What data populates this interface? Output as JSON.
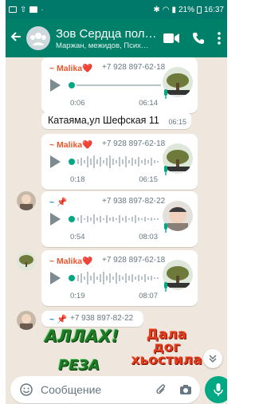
{
  "status_bar": {
    "battery": "21%",
    "time": "16:37"
  },
  "header": {
    "back_icon": "arrow-left-icon",
    "title": "Зов Сердца пол…",
    "subtitle": "Маржан, межидов, Псих…",
    "icons": [
      "video-call-icon",
      "phone-call-icon",
      "more-vert-icon"
    ],
    "accent": "#008069"
  },
  "messages": [
    {
      "type": "voice",
      "sender": "~ Malika❤️",
      "phone": "+7 928 897-62-18",
      "duration": "0:06",
      "time": "06:14"
    },
    {
      "type": "text",
      "text": "Катаяма,ул Шефская 11",
      "time": "06:15"
    },
    {
      "type": "voice",
      "sender": "~ Malika❤️",
      "phone": "+7 928 897-62-18",
      "duration": "0:18",
      "time": "06:15"
    },
    {
      "type": "voice",
      "sender": "~ 📌",
      "phone": "+7 938 897-82-22",
      "duration": "0:54",
      "time": "08:03"
    },
    {
      "type": "voice",
      "sender": "~ Malika❤️",
      "phone": "+7 928 897-62-18",
      "duration": "0:19",
      "time": "08:07"
    },
    {
      "type": "sticker",
      "sender": "~ 📌",
      "phone": "+7 938 897-82-22",
      "sticker_left": [
        "АЛЛАХ!",
        "РЕЗА"
      ],
      "sticker_right": [
        "Дала",
        "дог",
        "хьостила"
      ]
    }
  ],
  "input": {
    "placeholder": "Сообщение"
  },
  "colors": {
    "chat_bg": "#efe7de",
    "sender_red": "#e8562c",
    "green": "#00a884"
  }
}
